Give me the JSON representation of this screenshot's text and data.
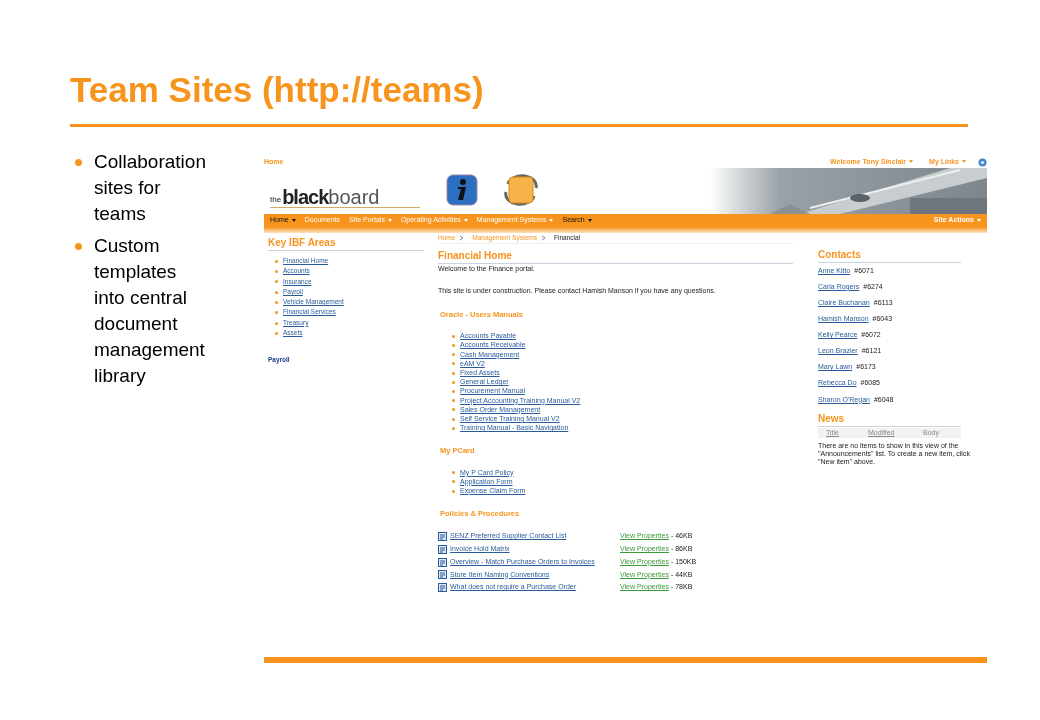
{
  "slide": {
    "title": "Team Sites (http://teams)",
    "bullets": [
      "Collaboration sites for teams",
      "Custom templates into central document management library"
    ]
  },
  "site": {
    "top": {
      "home": "Home",
      "welcome": "Welcome Tony Sinclair",
      "my_links": "My Links"
    },
    "logo": {
      "prefix": "the",
      "bold": "black",
      "light": "board"
    },
    "nav": [
      {
        "label": "Home",
        "has_menu": true,
        "selected": true
      },
      {
        "label": "Documents",
        "has_menu": false,
        "selected": false
      },
      {
        "label": "Site Portals",
        "has_menu": true,
        "selected": false
      },
      {
        "label": "Operating Activities",
        "has_menu": true,
        "selected": false
      },
      {
        "label": "Management Systems",
        "has_menu": true,
        "selected": false
      },
      {
        "label": "Search",
        "has_menu": true,
        "selected": true
      }
    ],
    "site_actions": "Site Actions",
    "left": {
      "heading": "Key IBF Areas",
      "items": [
        "Financial Home",
        "Accounts",
        "Insurance",
        "Payroll",
        "Vehicle Management",
        "Financial Services",
        "Treasury",
        "Assets"
      ],
      "footer": "Payroll"
    },
    "breadcrumb": [
      "Home",
      "Management Systems",
      "Financial"
    ],
    "main": {
      "title": "Financial Home",
      "welcome": "Welcome to the Finance portal.",
      "notice": "This site is under construction. Please contact Hamish Manson if you have any questions.",
      "sections": [
        {
          "title": "Oracle - Users Manuals",
          "kind": "list",
          "items": [
            {
              "label": "Accounts Payable"
            },
            {
              "label": "Accounts Receivable"
            },
            {
              "label": "Cash Management"
            },
            {
              "label": "eAM V2"
            },
            {
              "label": "Fixed Assets"
            },
            {
              "label": "General Ledger"
            },
            {
              "label": "Procurement Manual"
            },
            {
              "label": "Project Accounting Training Manual V2"
            },
            {
              "label": "Sales Order Management"
            },
            {
              "label": "Self Service Training Manual V2"
            },
            {
              "label": "Training Manual - Basic Navigation"
            }
          ]
        },
        {
          "title": "My PCard",
          "kind": "list",
          "items": [
            {
              "label": "My P Card Policy"
            },
            {
              "label": "Application Form"
            },
            {
              "label": "Expense Claim Form"
            }
          ]
        },
        {
          "title": "Policies & Procedures",
          "kind": "docs",
          "items": [
            {
              "label": "SENZ Preferred Supplier Contact List",
              "link": "View Properties",
              "size": "- 46KB"
            },
            {
              "label": "Invoice Hold Matrix",
              "link": "View Properties",
              "size": "- 86KB"
            },
            {
              "label": "Overview - Match Purchase Orders to Invoices",
              "link": "View Properties",
              "size": "- 150KB"
            },
            {
              "label": "Store Item Naming Conventions",
              "link": "View Properties",
              "size": "- 44KB"
            },
            {
              "label": "What does not require a Purchase Order",
              "link": "View Properties",
              "size": "- 78KB"
            }
          ]
        }
      ]
    },
    "contacts": {
      "heading": "Contacts",
      "items": [
        {
          "name": "Anne Kitto",
          "ext": "#6071"
        },
        {
          "name": "Carla Rogers",
          "ext": "#6274"
        },
        {
          "name": "Claire Buchanan",
          "ext": "#6113"
        },
        {
          "name": "Hamish Manson",
          "ext": "#6043"
        },
        {
          "name": "Kelly Pearce",
          "ext": "#6072"
        },
        {
          "name": "Leon Brazier",
          "ext": "#6121"
        },
        {
          "name": "Mary Lawn",
          "ext": "#6173"
        },
        {
          "name": "Rebecca Do",
          "ext": "#6085"
        },
        {
          "name": "Sharon O'Regan",
          "ext": "#6048"
        }
      ]
    },
    "news": {
      "heading": "News",
      "columns": [
        "Title",
        "Modified",
        "Body"
      ],
      "empty": "There are no items to show in this view of the \"Announcements\" list. To create a new item, click \"New item\" above."
    }
  }
}
